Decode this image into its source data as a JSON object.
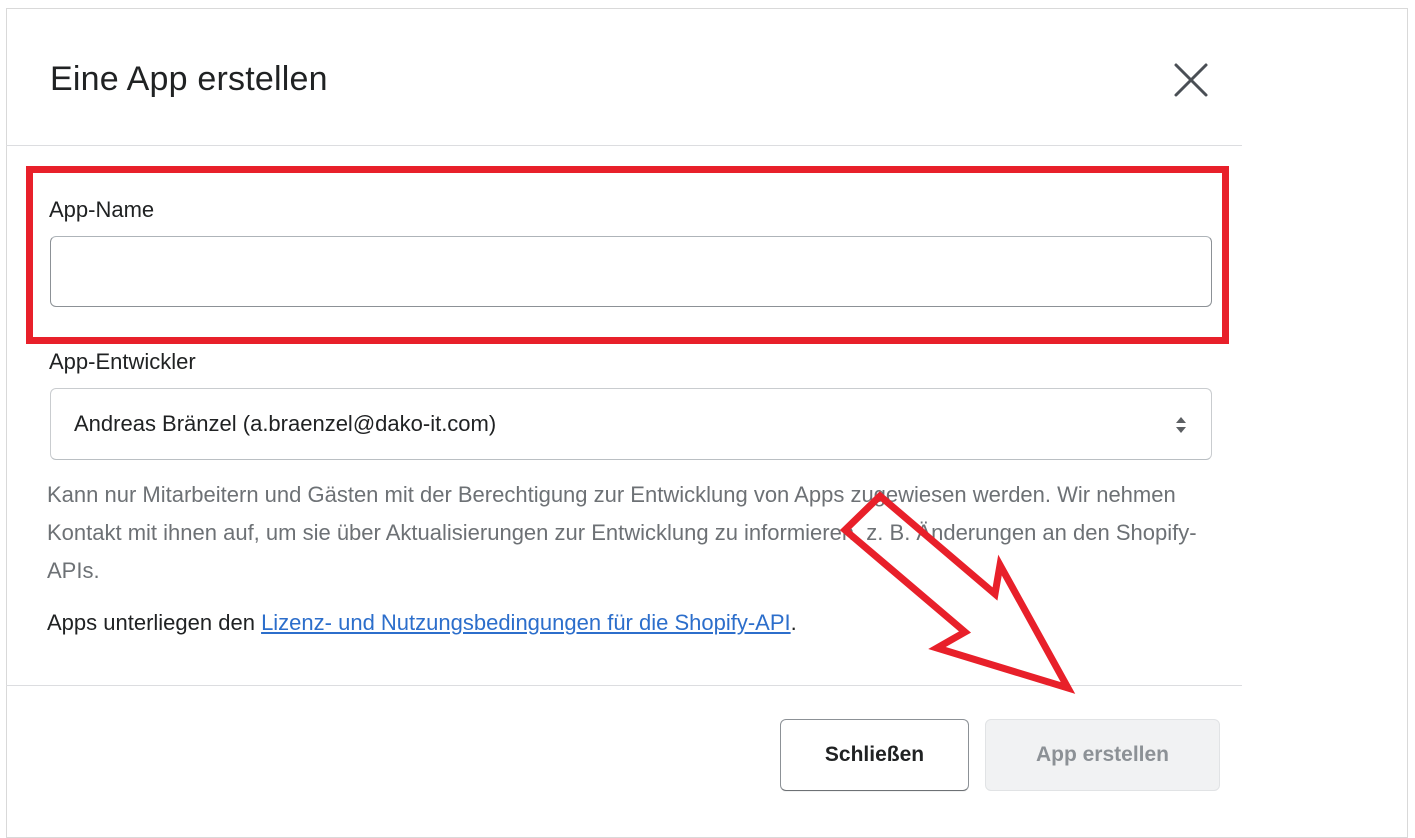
{
  "modal": {
    "title": "Eine App erstellen",
    "close_icon": "close-icon"
  },
  "form": {
    "app_name": {
      "label": "App-Name",
      "value": "",
      "placeholder": ""
    },
    "developer": {
      "label": "App-Entwickler",
      "selected": "Andreas Bränzel (a.braenzel@dako-it.com)",
      "arrow_icon": "select-arrows-icon"
    },
    "help_text": "Kann nur Mitarbeitern und Gästen mit der Berechtigung zur Entwicklung von Apps zugewiesen werden. Wir nehmen Kontakt mit ihnen auf, um sie über Aktualisierungen zur Entwicklung zu informieren, z. B. Änderungen an den Shopify-APIs.",
    "terms_prefix": "Apps unterliegen den ",
    "terms_link": "Lizenz- und Nutzungsbedingungen für die Shopify-API",
    "terms_suffix": "."
  },
  "footer": {
    "close_label": "Schließen",
    "create_label": "App erstellen"
  },
  "annotation": {
    "highlight_color": "#e8202a",
    "arrow_icon": "red-arrow-annotation"
  },
  "colors": {
    "link": "#2c6ecb",
    "help_text": "#6d7175",
    "disabled_button_bg": "#f1f2f3",
    "disabled_button_text": "#8c9196"
  }
}
